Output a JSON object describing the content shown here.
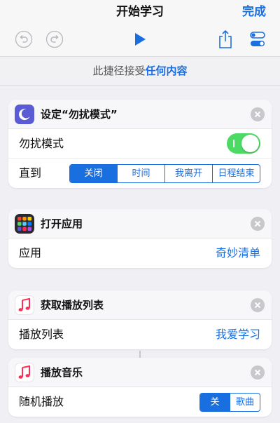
{
  "nav": {
    "title": "开始学习",
    "done": "完成"
  },
  "toolbar": {
    "icons": [
      "undo-icon",
      "redo-icon",
      "play-icon",
      "share-icon",
      "settings-toggle-icon"
    ]
  },
  "banner": {
    "prefix": "此捷径接受",
    "value": "任何内容"
  },
  "colors": {
    "accent": "#1a6fe0",
    "toggle_on": "#4cd964",
    "dnd_icon": "#5b5bd6"
  },
  "dnd_card": {
    "title": "设定“勿扰模式”",
    "toggle_label": "勿扰模式",
    "toggle_on": true,
    "until_label": "直到",
    "until_options": [
      "关闭",
      "时间",
      "我离开",
      "日程结束"
    ],
    "until_selected": "关闭"
  },
  "open_app_card": {
    "title": "打开应用",
    "row_label": "应用",
    "row_value": "奇妙清单"
  },
  "playlist_card": {
    "title": "获取播放列表",
    "row_label": "播放列表",
    "row_value": "我爱学习"
  },
  "music_card": {
    "title": "播放音乐",
    "shuffle_label": "随机播放",
    "shuffle_options": [
      "关",
      "歌曲"
    ],
    "shuffle_selected": "关"
  }
}
